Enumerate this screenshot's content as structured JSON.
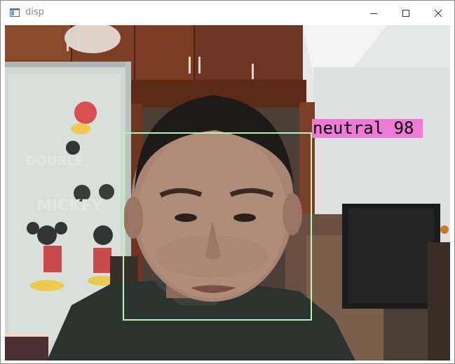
{
  "window": {
    "title": "disp",
    "controls": {
      "minimize_icon": "minimize-icon",
      "maximize_icon": "maximize-icon",
      "close_icon": "close-icon"
    }
  },
  "detection": {
    "label": "neutral 98",
    "box_color": "#b9f5b2",
    "label_background": "#f07ad7"
  }
}
